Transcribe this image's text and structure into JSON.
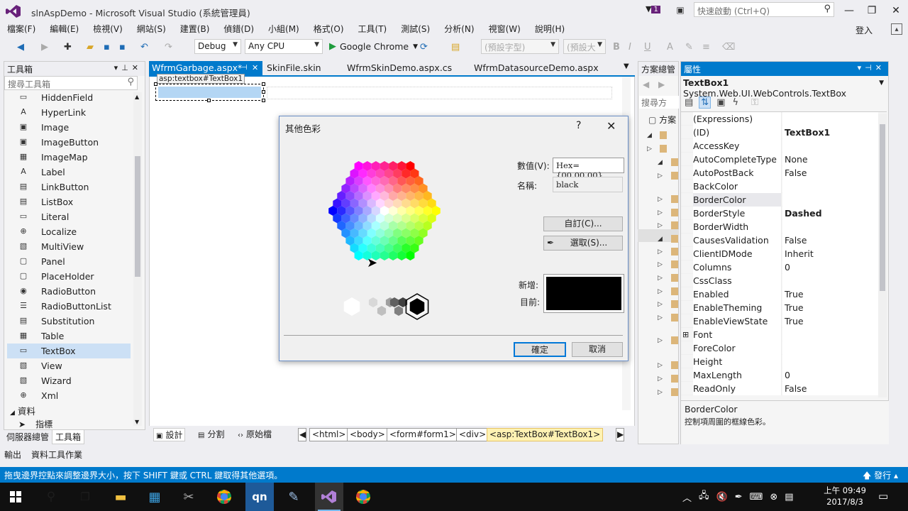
{
  "window": {
    "title": "slnAspDemo - Microsoft Visual Studio (系統管理員)",
    "notification_count": "1",
    "quick_launch_placeholder": "快速啟動 (Ctrl+Q)",
    "login": "登入"
  },
  "menu": [
    "檔案(F)",
    "編輯(E)",
    "檢視(V)",
    "網站(S)",
    "建置(B)",
    "偵錯(D)",
    "小組(M)",
    "格式(O)",
    "工具(T)",
    "測試(S)",
    "分析(N)",
    "視窗(W)",
    "說明(H)"
  ],
  "toolbar": {
    "config": "Debug",
    "platform": "Any CPU",
    "run_target": "Google Chrome",
    "block_format": "(預設字型)",
    "font_size": "(預設大"
  },
  "toolbox": {
    "title": "工具箱",
    "search_placeholder": "搜尋工具箱",
    "items": [
      {
        "label": "HiddenField",
        "glyph": "▭"
      },
      {
        "label": "HyperLink",
        "glyph": "A"
      },
      {
        "label": "Image",
        "glyph": "▣"
      },
      {
        "label": "ImageButton",
        "glyph": "▣"
      },
      {
        "label": "ImageMap",
        "glyph": "▦"
      },
      {
        "label": "Label",
        "glyph": "A"
      },
      {
        "label": "LinkButton",
        "glyph": "▤"
      },
      {
        "label": "ListBox",
        "glyph": "▤"
      },
      {
        "label": "Literal",
        "glyph": "▭"
      },
      {
        "label": "Localize",
        "glyph": "⊕"
      },
      {
        "label": "MultiView",
        "glyph": "▧"
      },
      {
        "label": "Panel",
        "glyph": "▢"
      },
      {
        "label": "PlaceHolder",
        "glyph": "▢"
      },
      {
        "label": "RadioButton",
        "glyph": "◉"
      },
      {
        "label": "RadioButtonList",
        "glyph": "☰"
      },
      {
        "label": "Substitution",
        "glyph": "▤"
      },
      {
        "label": "Table",
        "glyph": "▦"
      },
      {
        "label": "TextBox",
        "glyph": "▭"
      },
      {
        "label": "View",
        "glyph": "▧"
      },
      {
        "label": "Wizard",
        "glyph": "▧"
      },
      {
        "label": "Xml",
        "glyph": "⊕"
      }
    ],
    "group_data": "資料",
    "pointer": "指標",
    "bottom_tabs": [
      "伺服器總管",
      "工具箱"
    ]
  },
  "editor": {
    "tabs": [
      "WfrmGarbage.aspx*",
      "SkinFile.skin",
      "WfrmSkinDemo.aspx.cs",
      "WfrmDatasourceDemo.aspx"
    ],
    "control_tag": "asp:textbox#TextBox1",
    "view_tabs": [
      "設計",
      "分割",
      "原始檔"
    ],
    "breadcrumbs": [
      "<html>",
      "<body>",
      "<form#form1>",
      "<div>",
      "<asp:TextBox#TextBox1>"
    ]
  },
  "dialog": {
    "title": "其他色彩",
    "help": "?",
    "value_label": "數值(V):",
    "value": "Hex={00,00,00}",
    "name_label": "名稱:",
    "name": "black",
    "custom_button": "自訂(C)...",
    "pick_button": "選取(S)...",
    "new_label": "新增:",
    "current_label": "目前:",
    "ok": "確定",
    "cancel": "取消",
    "selected_color": "#000000"
  },
  "solution": {
    "title": "方案總管",
    "search": "搜尋方",
    "root": "方案"
  },
  "properties": {
    "title": "屬性",
    "object": "TextBox1",
    "object_type": "System.Web.UI.WebControls.TextBox",
    "rows": [
      {
        "name": "(Expressions)",
        "value": ""
      },
      {
        "name": "(ID)",
        "value": "TextBox1",
        "bold": true
      },
      {
        "name": "AccessKey",
        "value": ""
      },
      {
        "name": "AutoCompleteType",
        "value": "None"
      },
      {
        "name": "AutoPostBack",
        "value": "False"
      },
      {
        "name": "BackColor",
        "value": ""
      },
      {
        "name": "BorderColor",
        "value": "",
        "hl": true
      },
      {
        "name": "BorderStyle",
        "value": "Dashed",
        "bold": true
      },
      {
        "name": "BorderWidth",
        "value": ""
      },
      {
        "name": "CausesValidation",
        "value": "False"
      },
      {
        "name": "ClientIDMode",
        "value": "Inherit"
      },
      {
        "name": "Columns",
        "value": "0"
      },
      {
        "name": "CssClass",
        "value": ""
      },
      {
        "name": "Enabled",
        "value": "True"
      },
      {
        "name": "EnableTheming",
        "value": "True"
      },
      {
        "name": "EnableViewState",
        "value": "True"
      },
      {
        "name": "Font",
        "value": "",
        "expand": true
      },
      {
        "name": "ForeColor",
        "value": ""
      },
      {
        "name": "Height",
        "value": ""
      },
      {
        "name": "MaxLength",
        "value": "0"
      },
      {
        "name": "ReadOnly",
        "value": "False"
      }
    ],
    "desc_title": "BorderColor",
    "desc_text": "控制項周圍的框線色彩。"
  },
  "output_tabs": [
    "輸出",
    "資料工具作業"
  ],
  "status": {
    "message": "拖曳邊界控點來調整邊界大小，按下 SHIFT 鍵或 CTRL 鍵取得其他選項。",
    "publish": "發行"
  },
  "taskbar": {
    "time": "上午 09:49",
    "date": "2017/8/3"
  },
  "colors": {
    "accent": "#007acc",
    "selection": "#cce0f5",
    "statusbar": "#007acc"
  }
}
